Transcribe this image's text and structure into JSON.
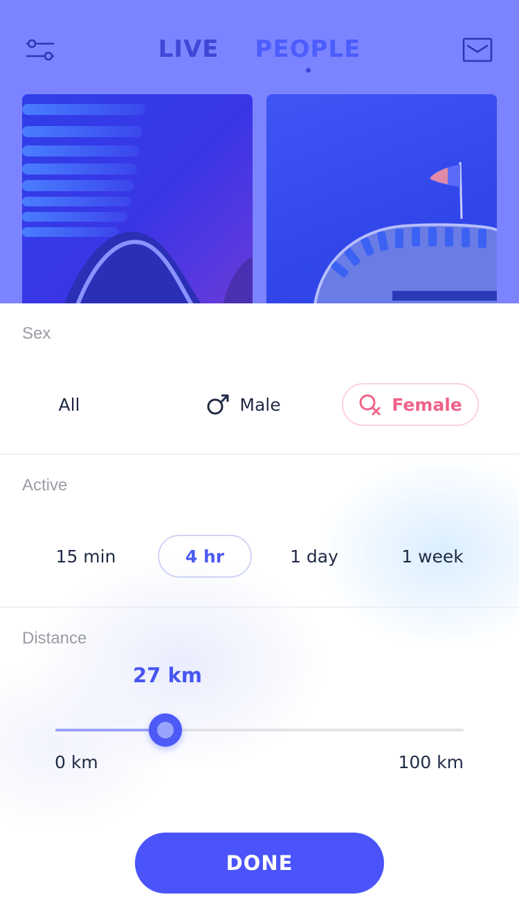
{
  "header": {
    "tabs": [
      {
        "label": "LIVE",
        "active": false
      },
      {
        "label": "PEOPLE",
        "active": true
      }
    ],
    "left_icon": "filter-sliders-icon",
    "right_icon": "mail-icon"
  },
  "filters": {
    "sex": {
      "title": "Sex",
      "options": [
        {
          "label": "All",
          "icon": null,
          "selected": false
        },
        {
          "label": "Male",
          "icon": "male-icon",
          "selected": false
        },
        {
          "label": "Female",
          "icon": "female-icon",
          "selected": true
        }
      ]
    },
    "active": {
      "title": "Active",
      "options": [
        {
          "label": "15 min",
          "selected": false
        },
        {
          "label": "4 hr",
          "selected": true
        },
        {
          "label": "1 day",
          "selected": false
        },
        {
          "label": "1 week",
          "selected": false
        }
      ]
    },
    "distance": {
      "title": "Distance",
      "value_label": "27 km",
      "value": 27,
      "min": 0,
      "max": 100,
      "min_label": "0 km",
      "max_label": "100 km"
    }
  },
  "done_button": {
    "label": "DONE"
  },
  "colors": {
    "accent": "#4a54fa",
    "female_accent": "#ef6288",
    "overlay": "#7b84fe"
  }
}
